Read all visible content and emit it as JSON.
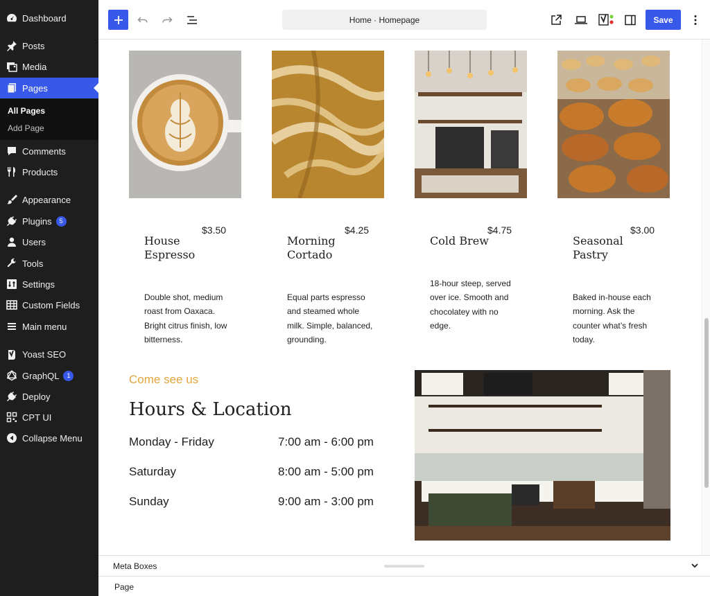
{
  "sidebar": {
    "items": [
      {
        "label": "Dashboard",
        "icon": "dashboard-icon"
      },
      {
        "label": "Posts",
        "icon": "pin-icon"
      },
      {
        "label": "Media",
        "icon": "media-icon"
      },
      {
        "label": "Pages",
        "icon": "pages-icon"
      },
      {
        "label": "Comments",
        "icon": "comment-icon"
      },
      {
        "label": "Products",
        "icon": "utensils-icon"
      },
      {
        "label": "Appearance",
        "icon": "brush-icon"
      },
      {
        "label": "Plugins",
        "icon": "plugin-icon",
        "badge": "5"
      },
      {
        "label": "Users",
        "icon": "user-icon"
      },
      {
        "label": "Tools",
        "icon": "wrench-icon"
      },
      {
        "label": "Settings",
        "icon": "settings-icon"
      },
      {
        "label": "Custom Fields",
        "icon": "table-icon"
      },
      {
        "label": "Main menu",
        "icon": "menu-icon"
      },
      {
        "label": "Yoast SEO",
        "icon": "yoast-icon"
      },
      {
        "label": "GraphQL",
        "icon": "graphql-icon",
        "badge": "1"
      },
      {
        "label": "Deploy",
        "icon": "plugin-icon"
      },
      {
        "label": "CPT UI",
        "icon": "qr-icon"
      },
      {
        "label": "Collapse Menu",
        "icon": "collapse-icon"
      }
    ],
    "submenu": {
      "all_pages": "All Pages",
      "add_page": "Add Page"
    },
    "accent": "#3858e9"
  },
  "toolbar": {
    "document_title": "Home · Homepage",
    "save_label": "Save"
  },
  "products": [
    {
      "name": "House Espresso",
      "price": "$3.50",
      "desc": "Double shot, medium roast from Oaxaca. Bright citrus finish, low bitterness."
    },
    {
      "name": "Morning Cortado",
      "price": "$4.25",
      "desc": "Equal parts espresso and steamed whole milk. Simple, balanced, grounding."
    },
    {
      "name": "Cold Brew",
      "price": "$4.75",
      "desc": "18-hour steep, served over ice. Smooth and chocolatey with no edge."
    },
    {
      "name": "Seasonal Pastry",
      "price": "$3.00",
      "desc": "Baked in-house each morning. Ask the counter what’s fresh today."
    }
  ],
  "hours": {
    "eyebrow": "Come see us",
    "title": "Hours & Location",
    "rows": [
      {
        "day": "Monday - Friday",
        "time": "7:00 am - 6:00 pm"
      },
      {
        "day": "Saturday",
        "time": "8:00 am - 5:00 pm"
      },
      {
        "day": "Sunday",
        "time": "9:00 am - 3:00 pm"
      }
    ],
    "accent": "#e0a63c"
  },
  "footer": {
    "meta_boxes": "Meta Boxes",
    "breadcrumb": "Page"
  }
}
